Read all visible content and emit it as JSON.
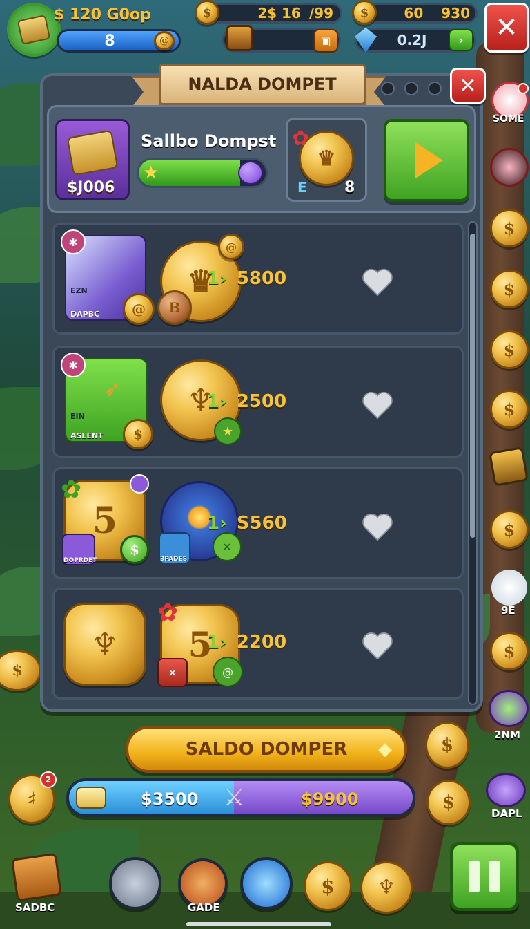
{
  "hud": {
    "balance_label": "$ 120 G0op",
    "level_value": "8",
    "energy_text": "2$ 16",
    "energy_max": "/99",
    "coins_value": "60",
    "coins_max": "930",
    "gems_value": "0.2J"
  },
  "dialog": {
    "title": "NALDA DOMPET",
    "card_title": "Sallbo Dompst",
    "wallet_value": "$J006",
    "chest_letter": "E",
    "chest_count": "8"
  },
  "offers": [
    {
      "qty_label": "1",
      "amount": "5800",
      "tag_top": "EZN",
      "tag_bottom": "DAPBC"
    },
    {
      "qty_label": "1",
      "amount": "2500",
      "tag_top": "EIN",
      "tag_bottom": "ASLENT"
    },
    {
      "qty_label": "1",
      "amount": "S560",
      "tag_top": "",
      "tag_bottom": "DOPRDET",
      "tag_bottom_2": "3PADES",
      "coin_digit": "5"
    },
    {
      "qty_label": "1",
      "amount": "2200",
      "coin_digit": "5"
    }
  ],
  "cta": {
    "label": "SALDO DOMPER"
  },
  "progress": {
    "left_value": "$3500",
    "right_value": "$9900",
    "fill_fraction": 0.48
  },
  "side_rail": [
    {
      "label": "SOME"
    },
    {
      "label": "9E"
    },
    {
      "label": "2NM"
    },
    {
      "label": "DAPL"
    }
  ],
  "bottom_nav": [
    {
      "label": "SADBC"
    },
    {
      "label": "GADE"
    }
  ],
  "badges": {
    "coin_badge": "2"
  },
  "colors": {
    "accent_green": "#5cc23a",
    "accent_gold": "#f5c23a",
    "close_red": "#d8302a",
    "panel": "#3a4858"
  }
}
